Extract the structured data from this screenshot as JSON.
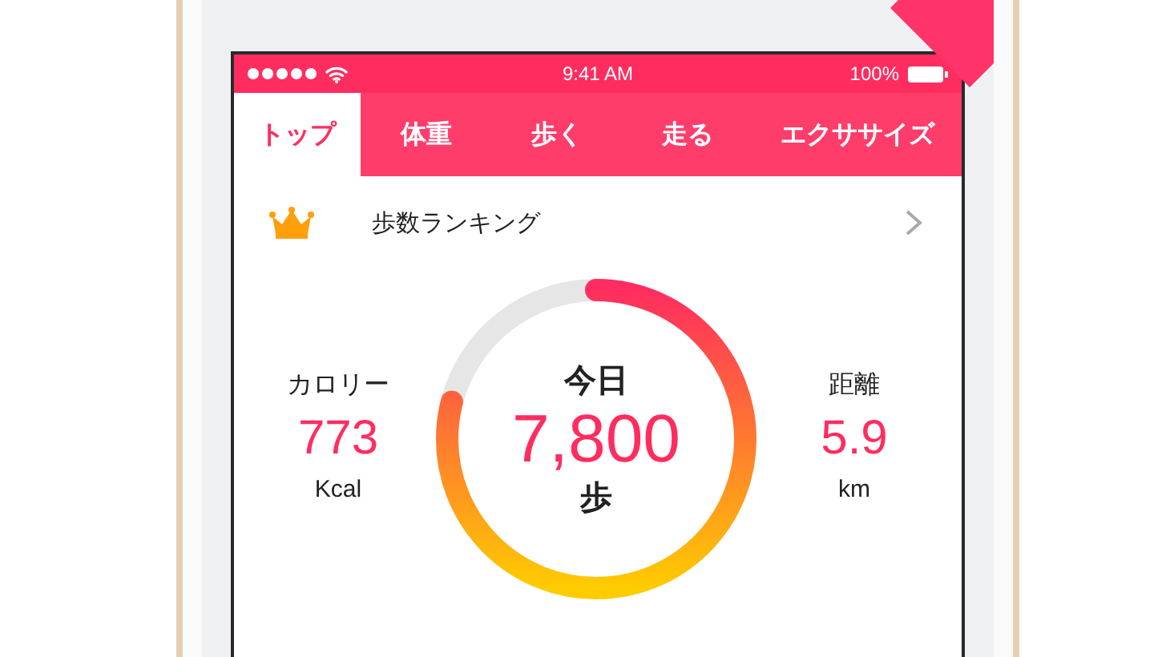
{
  "status_bar": {
    "time": "9:41 AM",
    "battery": "100%"
  },
  "tabs": [
    {
      "label": "トップ",
      "selected": true
    },
    {
      "label": "体重",
      "selected": false
    },
    {
      "label": "歩く",
      "selected": false
    },
    {
      "label": "走る",
      "selected": false
    },
    {
      "label": "エクササイズ",
      "selected": false
    }
  ],
  "ranking": {
    "title": "歩数ランキング"
  },
  "today": {
    "label": "今日",
    "steps": "7,800",
    "unit": "歩",
    "level": 0.79
  },
  "stats": [
    {
      "label": "カロリー",
      "value": "773",
      "unit": "Kcal"
    },
    {
      "label": "距離",
      "value": "5.9",
      "unit": "km"
    }
  ]
}
